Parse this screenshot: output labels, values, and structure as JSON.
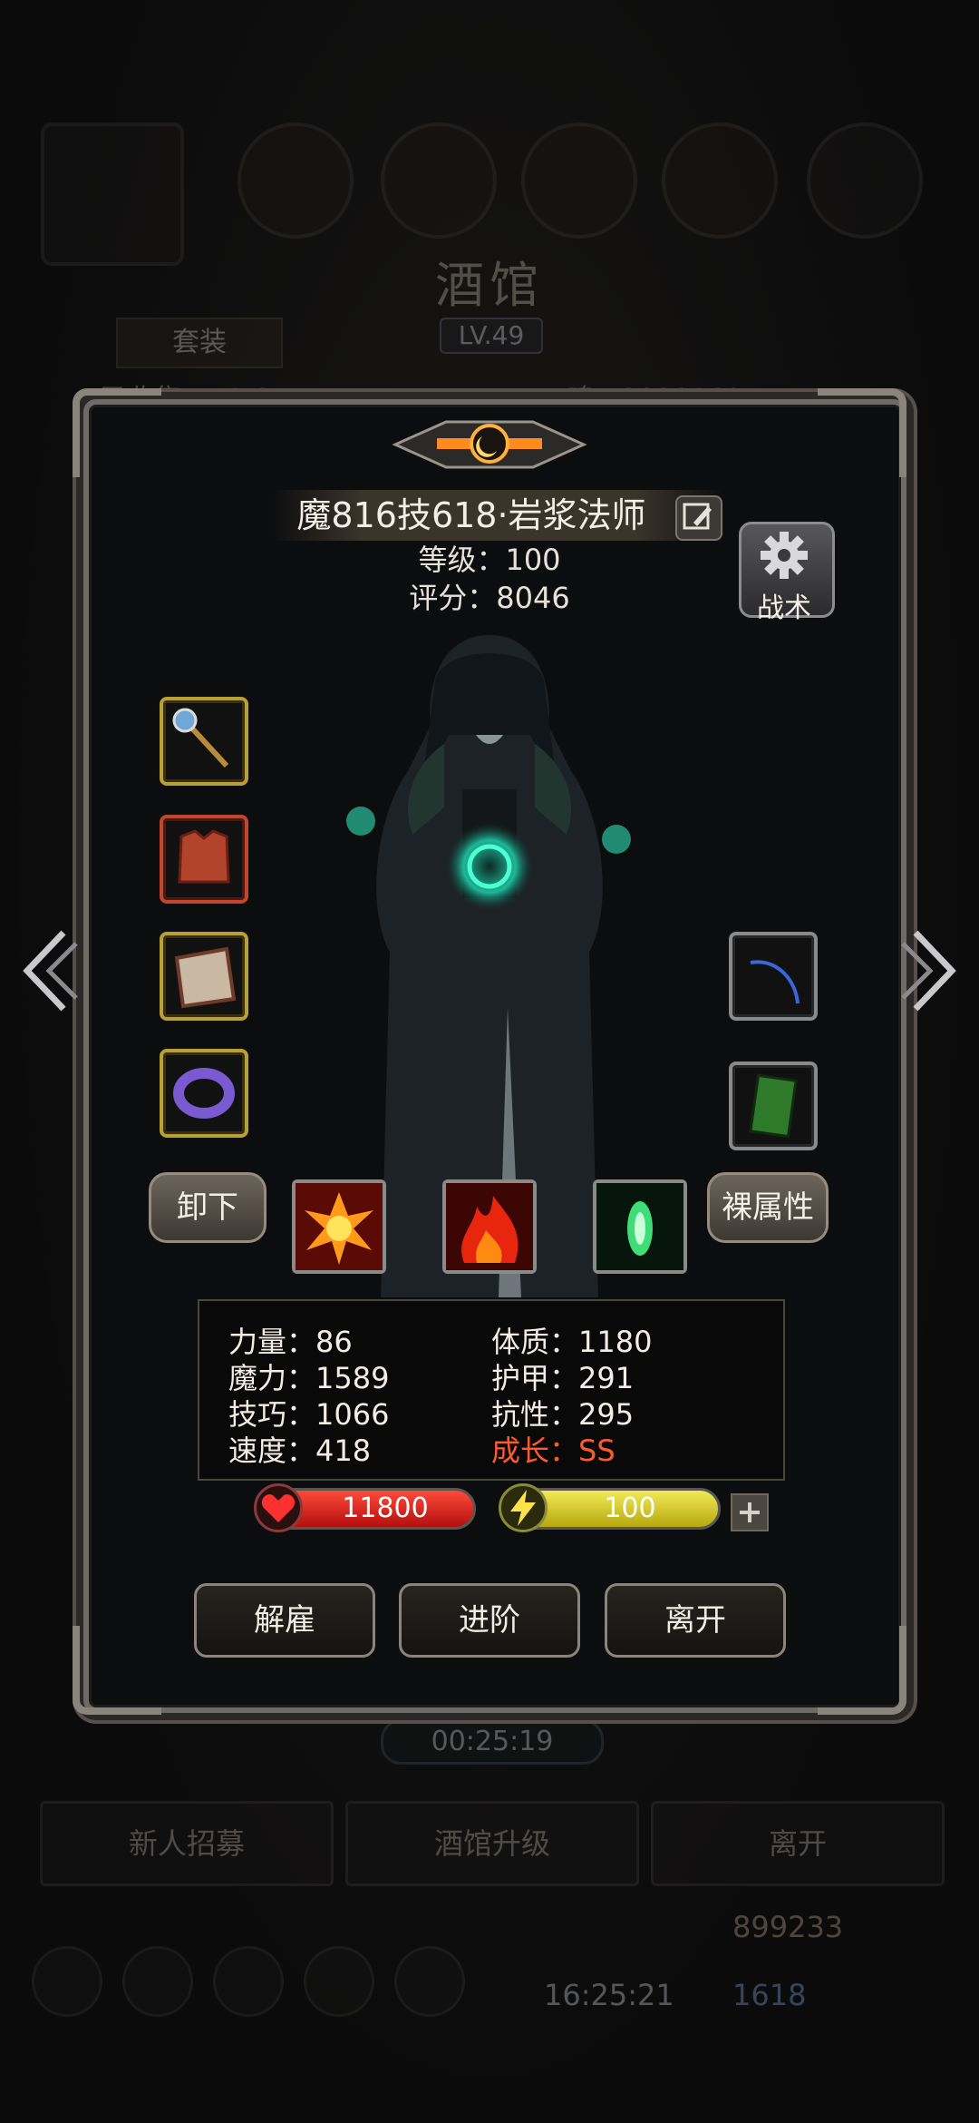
{
  "background": {
    "title": "酒馆",
    "level": "LV.49",
    "tab_outfit": "套装",
    "recruit_count": "已收集：41/64",
    "soul": "魂：3939160",
    "timer": "00:25:19",
    "buttons": [
      "新人招募",
      "酒馆升级",
      "离开"
    ],
    "gold": "899233",
    "gems": "1618",
    "clock": "16:25:21"
  },
  "hero": {
    "name": "魔816技618·岩浆法师",
    "level": "等级：100",
    "score": "评分：8046",
    "tactics_label": "战术",
    "unequip_label": "卸下",
    "base_attr_label": "裸属性"
  },
  "stats": {
    "strength": "力量：86",
    "magic": "魔力：1589",
    "skill": "技巧：1066",
    "speed": "速度：418",
    "constitution": "体质：1180",
    "armor": "护甲：291",
    "resistance": "抗性：295",
    "growth": "成长：SS"
  },
  "bars": {
    "hp": "11800",
    "energy": "100"
  },
  "actions": {
    "dismiss": "解雇",
    "advance": "进阶",
    "leave": "离开"
  },
  "colors": {
    "growth_text": "#ff5a2c",
    "hp_bar": "#d4201a",
    "energy_bar": "#e3d52a",
    "gold_slot_border": "#b9a032",
    "red_slot_border": "#c2462e"
  }
}
